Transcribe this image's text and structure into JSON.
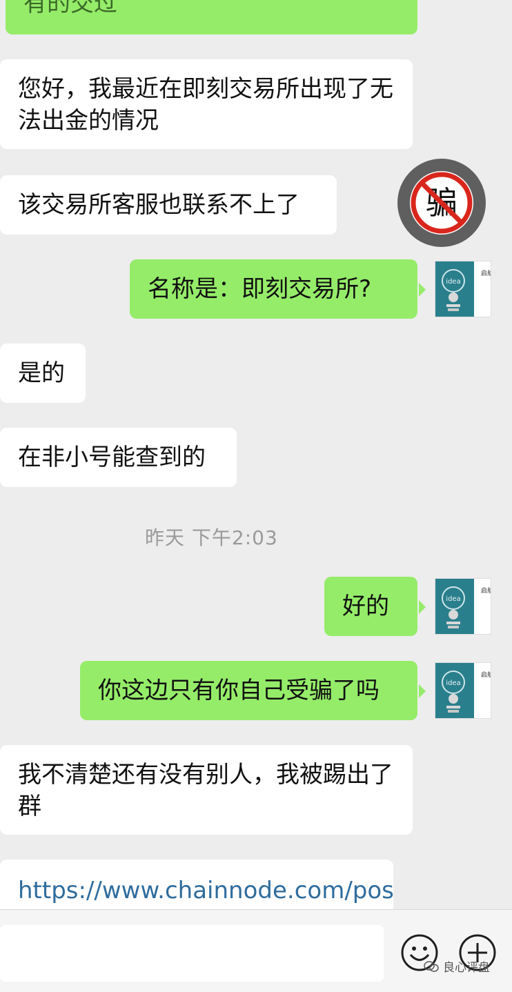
{
  "messages": [
    {
      "text": "有的交过"
    },
    {
      "text": "您好，我最近在即刻交易所出现了无法出金的情况"
    },
    {
      "text": "该交易所客服也联系不上了"
    },
    {
      "text": "名称是：即刻交易所?"
    },
    {
      "text": "是的"
    },
    {
      "text": "在非小号能查到的"
    },
    {
      "text": "好的"
    },
    {
      "text": "你这边只有你自己受骗了吗"
    },
    {
      "text": "我不清楚还有没有别人，我被踢出了群"
    },
    {
      "text": "https://www.chainnode.com/pos"
    }
  ],
  "timestamp": "昨天 下午2:03",
  "scam_stamp": "骗",
  "avatar": {
    "title": "启航",
    "bulb_text": "idea"
  },
  "watermark": "良心评盘",
  "colors": {
    "sent_bubble": "#95ec69",
    "received_bubble": "#ffffff",
    "background": "#ededed",
    "link": "#2f6c9d"
  }
}
